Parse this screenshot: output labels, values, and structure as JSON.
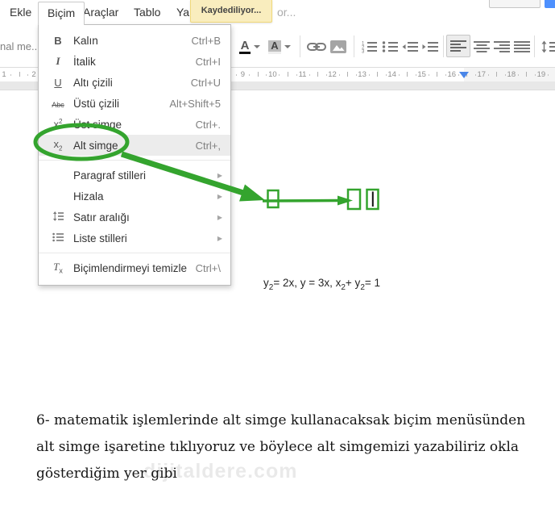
{
  "app": {
    "colors": {
      "accent_green": "#34a42e",
      "bubble_bg": "#f9edbe",
      "bubble_border": "#f0d97a",
      "marker_blue": "#4a86e8"
    },
    "saving_bubble": "Kaydediliyor...",
    "status_tail": "or..."
  },
  "menubar": {
    "items": [
      {
        "label": "Ekle"
      },
      {
        "label": "Biçim",
        "active": true
      },
      {
        "label": "Araçlar"
      },
      {
        "label": "Tablo"
      },
      {
        "label": "Yard"
      }
    ]
  },
  "toolbar": {
    "style_dropdown_value": "nal me...",
    "icons": [
      "text-color",
      "highlight-color",
      "insert-link",
      "insert-image",
      "numbered-list",
      "bulleted-list",
      "decrease-indent",
      "increase-indent",
      "align-left",
      "align-center",
      "align-right",
      "justify",
      "line-spacing"
    ],
    "active_icon": "align-left"
  },
  "format_menu": {
    "items": [
      {
        "icon": "bold-icon",
        "label": "Kalın",
        "shortcut": "Ctrl+B"
      },
      {
        "icon": "italic-icon",
        "label": "İtalik",
        "shortcut": "Ctrl+I"
      },
      {
        "icon": "underline-icon",
        "label": "Altı çizili",
        "shortcut": "Ctrl+U"
      },
      {
        "icon": "strikethrough-icon",
        "label": "Üstü çizili",
        "shortcut": "Alt+Shift+5"
      },
      {
        "icon": "superscript-icon",
        "label": "Üst simge",
        "shortcut": "Ctrl+."
      },
      {
        "icon": "subscript-icon",
        "label": "Alt simge",
        "shortcut": "Ctrl+,",
        "highlighted": true
      },
      {
        "separator": true
      },
      {
        "label": "Paragraf stilleri",
        "submenu": true
      },
      {
        "label": "Hizala",
        "submenu": true
      },
      {
        "icon": "line-spacing-icon",
        "label": "Satır aralığı",
        "submenu": true
      },
      {
        "icon": "list-styles-icon",
        "label": "Liste stilleri",
        "submenu": true
      },
      {
        "separator": true
      },
      {
        "icon": "clear-formatting-icon",
        "label": "Biçimlendirmeyi temizle",
        "shortcut": "Ctrl+\\"
      }
    ]
  },
  "ruler": {
    "numbers": [
      1,
      2,
      9,
      10,
      11,
      12,
      13,
      14,
      15,
      16,
      17,
      18,
      19
    ],
    "indent_marker_value": 16.4
  },
  "document": {
    "equation": {
      "s1": "y",
      "sub1": "2",
      "s2": "= 2x, y = 3x, x",
      "sub2": "2",
      "s3": "+ y",
      "sub3": "2",
      "s4": "= 1"
    },
    "paragraph_lines": [
      "6- matematik işlemlerinde alt simge kullanacaksak biçim menüsünden",
      "alt simge işaretine tıklıyoruz ve böylece alt simgemizi yazabiliriz okla",
      "gösterdiğim yer gibi"
    ],
    "watermark": "dijitaldere.com"
  }
}
